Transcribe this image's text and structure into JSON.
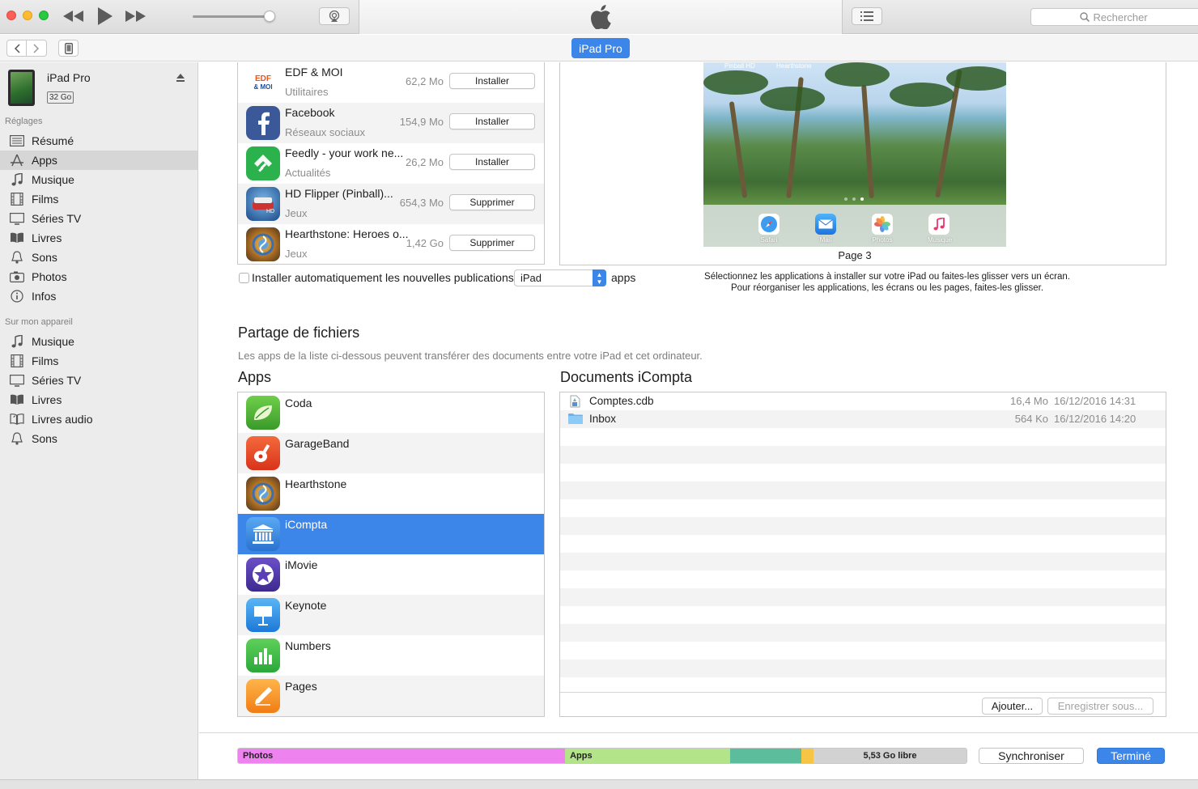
{
  "toolbar": {
    "search_placeholder": "Rechercher",
    "device_tab": "iPad Pro"
  },
  "sidebar": {
    "device": {
      "name": "iPad Pro",
      "capacity": "32 Go"
    },
    "section_settings": "Réglages",
    "settings_items": [
      {
        "label": "Résumé",
        "icon": "summary-icon"
      },
      {
        "label": "Apps",
        "icon": "apps-icon",
        "selected": true
      },
      {
        "label": "Musique",
        "icon": "music-icon"
      },
      {
        "label": "Films",
        "icon": "film-icon"
      },
      {
        "label": "Séries TV",
        "icon": "tv-icon"
      },
      {
        "label": "Livres",
        "icon": "book-icon"
      },
      {
        "label": "Sons",
        "icon": "bell-icon"
      },
      {
        "label": "Photos",
        "icon": "camera-icon"
      },
      {
        "label": "Infos",
        "icon": "info-icon"
      }
    ],
    "section_device": "Sur mon appareil",
    "device_items": [
      {
        "label": "Musique",
        "icon": "music-icon"
      },
      {
        "label": "Films",
        "icon": "film-icon"
      },
      {
        "label": "Séries TV",
        "icon": "tv-icon"
      },
      {
        "label": "Livres",
        "icon": "book-icon"
      },
      {
        "label": "Livres audio",
        "icon": "audiobook-icon"
      },
      {
        "label": "Sons",
        "icon": "bell-icon"
      }
    ]
  },
  "install_list": [
    {
      "name": "EDF & MOI",
      "category": "Utilitaires",
      "size": "62,2 Mo",
      "action": "Installer"
    },
    {
      "name": "Facebook",
      "category": "Réseaux sociaux",
      "size": "154,9 Mo",
      "action": "Installer"
    },
    {
      "name": "Feedly - your work ne...",
      "category": "Actualités",
      "size": "26,2 Mo",
      "action": "Installer"
    },
    {
      "name": "HD Flipper (Pinball)...",
      "category": "Jeux",
      "size": "654,3 Mo",
      "action": "Supprimer"
    },
    {
      "name": "Hearthstone: Heroes o...",
      "category": "Jeux",
      "size": "1,42 Go",
      "action": "Supprimer"
    }
  ],
  "edf_logo_text": {
    "line1": "EDF",
    "line2": "& MOI"
  },
  "preview": {
    "top_labels": [
      "Pinball HD",
      "Hearthstone"
    ],
    "dock_apps": [
      "Safari",
      "Mail",
      "Photos",
      "Musique"
    ],
    "page_label": "Page 3"
  },
  "auto_install": {
    "label": "Installer automatiquement les nouvelles publications",
    "select_value": "iPad",
    "suffix": "apps"
  },
  "hint": {
    "line1": "Sélectionnez les applications à installer sur votre iPad ou faites-les glisser vers un écran.",
    "line2": "Pour réorganiser les applications, les écrans ou les pages, faites-les glisser."
  },
  "file_sharing": {
    "title": "Partage de fichiers",
    "description": "Les apps de la liste ci-dessous peuvent transférer des documents entre votre iPad et cet ordinateur.",
    "apps_title": "Apps",
    "docs_title": "Documents iCompta",
    "apps": [
      {
        "name": "Coda"
      },
      {
        "name": "GarageBand"
      },
      {
        "name": "Hearthstone"
      },
      {
        "name": "iCompta",
        "selected": true
      },
      {
        "name": "iMovie"
      },
      {
        "name": "Keynote"
      },
      {
        "name": "Numbers"
      },
      {
        "name": "Pages"
      }
    ],
    "documents": [
      {
        "name": "Comptes.cdb",
        "size": "16,4 Mo",
        "date": "16/12/2016 14:31",
        "icon": "database-file-icon"
      },
      {
        "name": "Inbox",
        "size": "564 Ko",
        "date": "16/12/2016 14:20",
        "icon": "folder-icon"
      }
    ],
    "add_button": "Ajouter...",
    "save_button": "Enregistrer sous..."
  },
  "storage": {
    "segments": [
      {
        "label": "Photos",
        "color": "#ee82ee",
        "fraction": 0.449
      },
      {
        "label": "Apps",
        "color": "#b3e489",
        "fraction": 0.227
      },
      {
        "label": "",
        "color": "#5bbd9b",
        "fraction": 0.097
      },
      {
        "label": "",
        "color": "#f7c444",
        "fraction": 0.017
      },
      {
        "label": "5,53 Go libre",
        "color": "#d2d2d2",
        "fraction": 0.21
      }
    ]
  },
  "actions": {
    "sync": "Synchroniser",
    "done": "Terminé"
  },
  "colors": {
    "accent": "#3b86e8",
    "sidebar_bg": "#ececec",
    "selected_row": "#3b86e8"
  }
}
